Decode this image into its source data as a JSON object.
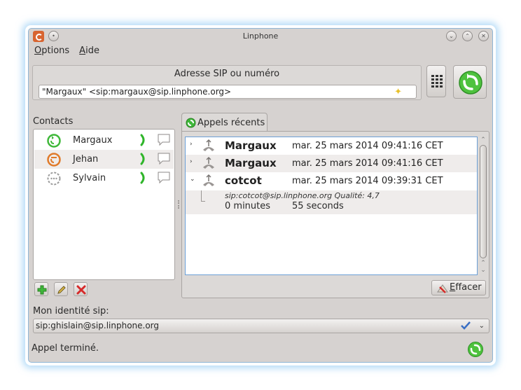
{
  "window": {
    "title": "Linphone"
  },
  "menu": {
    "options": {
      "underlined": "O",
      "rest": "ptions"
    },
    "help": {
      "underlined": "A",
      "rest": "ide"
    }
  },
  "sip": {
    "label": "Adresse SIP ou numéro",
    "value": "\"Margaux\" <sip:margaux@sip.linphone.org>"
  },
  "contacts": {
    "label": "Contacts",
    "items": [
      {
        "name": "Margaux",
        "status_color": "#3fb83a"
      },
      {
        "name": "Jehan",
        "status_color": "#e07a2a"
      },
      {
        "name": "Sylvain",
        "status_color": "#9a9a9a"
      }
    ]
  },
  "recent_calls": {
    "tab_label": "Appels récents",
    "calls": [
      {
        "name": "Margaux",
        "date": "mar. 25 mars 2014 09:41:16 CET",
        "expanded": false
      },
      {
        "name": "Margaux",
        "date": "mar. 25 mars 2014 09:41:16 CET",
        "expanded": false
      },
      {
        "name": "cotcot",
        "date": "mar. 25 mars 2014 09:39:31 CET",
        "expanded": true
      }
    ],
    "details": {
      "uri_quality": "sip:cotcot@sip.linphone.org Qualité: 4,7",
      "minutes": "0 minutes",
      "seconds": "55 seconds"
    },
    "clear_button": {
      "underlined": "E",
      "rest": "ffacer"
    }
  },
  "identity": {
    "label": "Mon identité sip:",
    "value": "sip:ghislain@sip.linphone.org"
  },
  "status": {
    "text": "Appel terminé."
  },
  "colors": {
    "accent_green": "#3fb83a",
    "selection_border": "#6b9fd6",
    "window_bg": "#d6d2d0"
  }
}
